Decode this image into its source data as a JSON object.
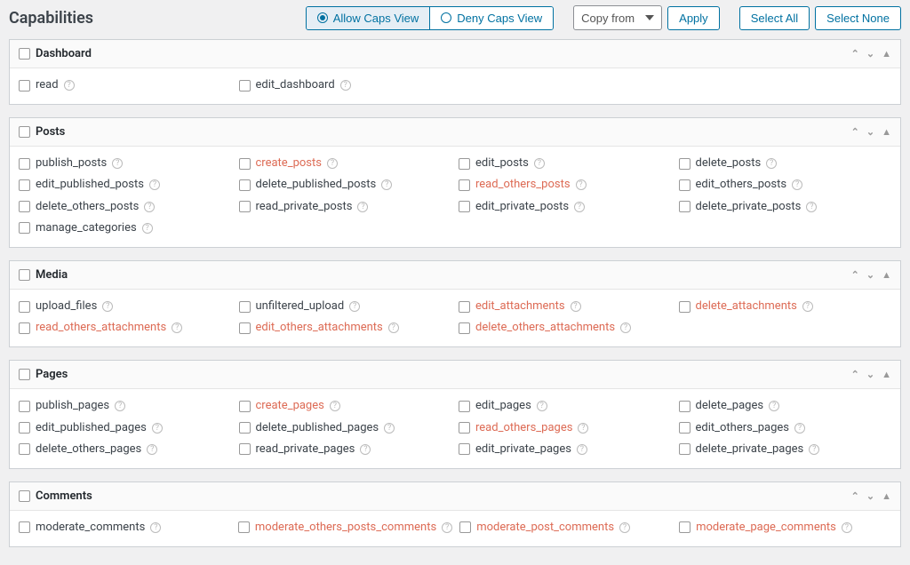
{
  "page_title": "Capabilities",
  "toolbar": {
    "allow_view": "Allow Caps View",
    "deny_view": "Deny Caps View",
    "copy_from": "Copy from",
    "apply": "Apply",
    "select_all": "Select All",
    "select_none": "Select None"
  },
  "panels": [
    {
      "title": "Dashboard",
      "caps": [
        {
          "label": "read",
          "has": true
        },
        {
          "label": "edit_dashboard",
          "has": true
        }
      ]
    },
    {
      "title": "Posts",
      "caps": [
        {
          "label": "publish_posts",
          "has": true
        },
        {
          "label": "create_posts",
          "has": false
        },
        {
          "label": "edit_posts",
          "has": true
        },
        {
          "label": "delete_posts",
          "has": true
        },
        {
          "label": "edit_published_posts",
          "has": true
        },
        {
          "label": "delete_published_posts",
          "has": true
        },
        {
          "label": "read_others_posts",
          "has": false
        },
        {
          "label": "edit_others_posts",
          "has": true
        },
        {
          "label": "delete_others_posts",
          "has": true
        },
        {
          "label": "read_private_posts",
          "has": true
        },
        {
          "label": "edit_private_posts",
          "has": true
        },
        {
          "label": "delete_private_posts",
          "has": true
        },
        {
          "label": "manage_categories",
          "has": true
        }
      ]
    },
    {
      "title": "Media",
      "caps": [
        {
          "label": "upload_files",
          "has": true
        },
        {
          "label": "unfiltered_upload",
          "has": true
        },
        {
          "label": "edit_attachments",
          "has": false
        },
        {
          "label": "delete_attachments",
          "has": false
        },
        {
          "label": "read_others_attachments",
          "has": false
        },
        {
          "label": "edit_others_attachments",
          "has": false
        },
        {
          "label": "delete_others_attachments",
          "has": false
        }
      ]
    },
    {
      "title": "Pages",
      "caps": [
        {
          "label": "publish_pages",
          "has": true
        },
        {
          "label": "create_pages",
          "has": false
        },
        {
          "label": "edit_pages",
          "has": true
        },
        {
          "label": "delete_pages",
          "has": true
        },
        {
          "label": "edit_published_pages",
          "has": true
        },
        {
          "label": "delete_published_pages",
          "has": true
        },
        {
          "label": "read_others_pages",
          "has": false
        },
        {
          "label": "edit_others_pages",
          "has": true
        },
        {
          "label": "delete_others_pages",
          "has": true
        },
        {
          "label": "read_private_pages",
          "has": true
        },
        {
          "label": "edit_private_pages",
          "has": true
        },
        {
          "label": "delete_private_pages",
          "has": true
        }
      ]
    },
    {
      "title": "Comments",
      "caps": [
        {
          "label": "moderate_comments",
          "has": true
        },
        {
          "label": "moderate_others_posts_comments",
          "has": false
        },
        {
          "label": "moderate_post_comments",
          "has": false
        },
        {
          "label": "moderate_page_comments",
          "has": false
        }
      ]
    }
  ]
}
